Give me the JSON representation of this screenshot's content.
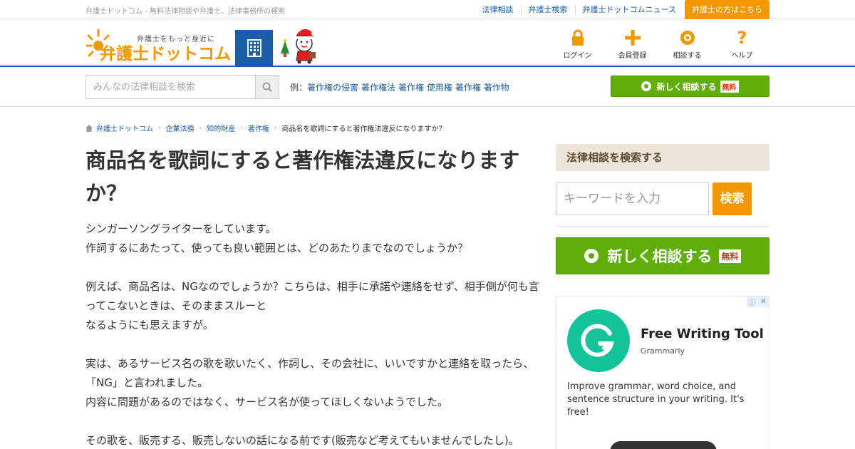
{
  "topbar": {
    "tagline": "弁護士ドットコム - 無料法律相談や弁護士、法律事務所の検索",
    "links": [
      "法律相談",
      "弁護士検索",
      "弁護士ドットコムニュース"
    ],
    "lawyer_button": "弁護士の方はこちら"
  },
  "header": {
    "logo_sub": "弁護士をもっと身近に",
    "logo_main": "弁護士ドットコム",
    "nav": [
      {
        "label": "ログイン",
        "icon": "lock-icon"
      },
      {
        "label": "会員登録",
        "icon": "plus-icon"
      },
      {
        "label": "相談する",
        "icon": "consult-icon"
      },
      {
        "label": "ヘルプ",
        "icon": "question-icon"
      }
    ]
  },
  "search": {
    "placeholder": "みんなの法律相談を検索",
    "examples_label": "例：",
    "examples": [
      "著作権の侵害",
      "著作権法",
      "著作権 使用権",
      "著作権 著作物"
    ],
    "new_consult_label": "新しく相談する",
    "free_badge": "無料"
  },
  "breadcrumb": [
    "弁護士ドットコム",
    "企業法務",
    "知的財産",
    "著作権",
    "商品名を歌詞にすると著作権法違反になりますか？"
  ],
  "article": {
    "title": "商品名を歌詞にすると著作権法違反になりますか？",
    "body": "シンガーソングライターをしています。\n作詞するにあたって、使っても良い範囲とは、どのあたりまでなのでしょうか？\n\n例えば、商品名は、NGなのでしょうか？こちらは、相手に承諾や連絡をせず、相手側が何も言ってこないときは、そのままスルーと\nなるようにも思えますが。\n\n実は、あるサービス名の歌を歌いたく、作詞し、その会社に、いいですかと連絡を取ったら、「NG」と言われました。\n内容に問題があるのではなく、サービス名が使ってほしくないようでした。\n\nその歌を、販売する、販売しないの話になる前です(販売など考えてもいませんでしたし)。"
  },
  "sidebar": {
    "heading": "法律相談を検索する",
    "keyword_placeholder": "キーワードを入力",
    "search_button": "検索",
    "new_consult_label": "新しく相談する",
    "free_badge": "無料"
  },
  "ad": {
    "title": "Free Writing Tool",
    "brand": "Grammarly",
    "description": "Improve grammar, word choice, and sentence structure in your writing. It's free!",
    "logo_color": "#15c39a"
  },
  "colors": {
    "brand_orange": "#f39800",
    "brand_blue": "#1a5ea8",
    "consult_green": "#5fae0a"
  }
}
